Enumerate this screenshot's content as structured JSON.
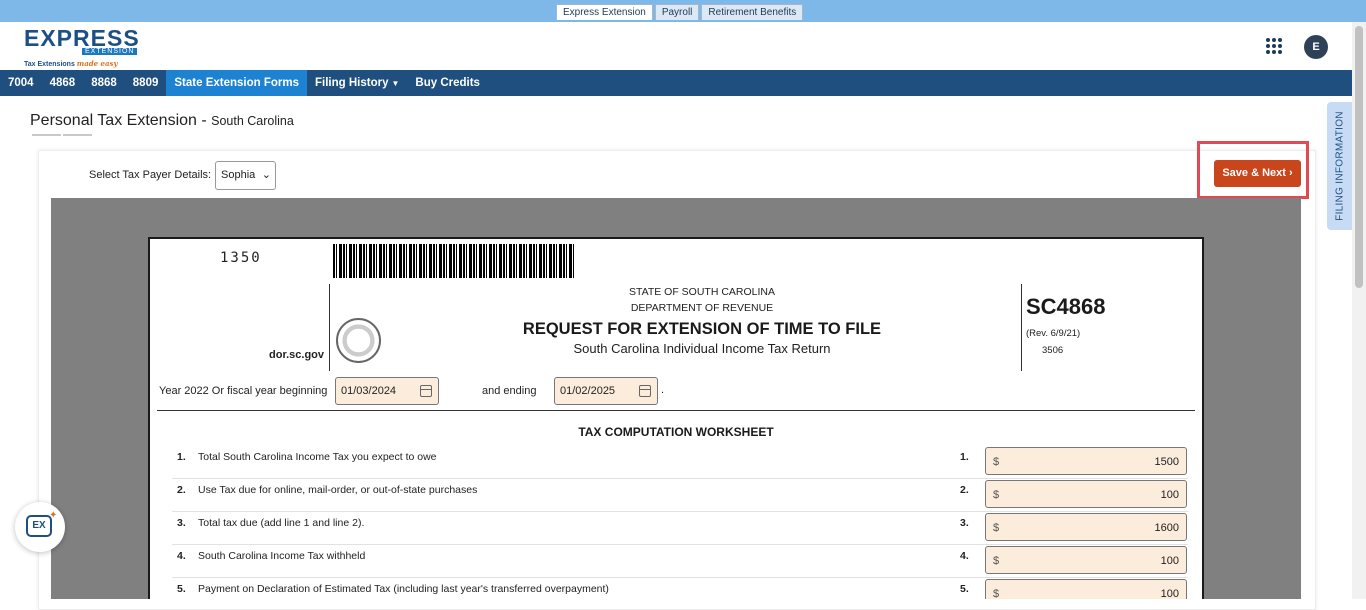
{
  "top_tabs": [
    {
      "label": "Express Extension",
      "active": true
    },
    {
      "label": "Payroll",
      "active": false
    },
    {
      "label": "Retirement Benefits",
      "active": false
    }
  ],
  "logo": {
    "main": "EXPRESS",
    "sub": "EXTENSION",
    "tag_a": "Tax Extensions",
    "tag_b": "made easy"
  },
  "user": {
    "avatar_initial": "E"
  },
  "nav": [
    {
      "label": "7004"
    },
    {
      "label": "4868"
    },
    {
      "label": "8868"
    },
    {
      "label": "8809"
    },
    {
      "label": "State Extension Forms",
      "active": true
    },
    {
      "label": "Filing History",
      "dropdown": true
    },
    {
      "label": "Buy Credits"
    }
  ],
  "page": {
    "title": "Personal Tax Extension - ",
    "subtitle": "South Carolina"
  },
  "taxpayer": {
    "label": "Select Tax Payer Details:",
    "selected": "Sophia"
  },
  "save_button": "Save & Next",
  "side_tab": "FILING INFORMATION",
  "form": {
    "number_code": "1350",
    "dor": "dor.sc.gov",
    "state_line1": "STATE OF SOUTH CAROLINA",
    "state_line2": "DEPARTMENT OF REVENUE",
    "title": "REQUEST FOR EXTENSION OF TIME TO FILE",
    "subtitle": "South Carolina Individual Income Tax Return",
    "form_no": "SC4868",
    "rev": "(Rev. 6/9/21)",
    "code": "3506",
    "year_label": "Year 2022 Or fiscal year beginning",
    "begin_date": "01/03/2024",
    "and_label": "and ending",
    "end_date": "01/02/2025",
    "worksheet_title": "TAX COMPUTATION WORKSHEET",
    "currency": "$",
    "lines": [
      {
        "num": "1.",
        "text": "Total South Carolina Income Tax you expect to owe",
        "amount": "1500"
      },
      {
        "num": "2.",
        "text": "Use Tax due for online, mail-order, or out-of-state purchases",
        "amount": "100"
      },
      {
        "num": "3.",
        "text": "Total tax due (add line 1 and line 2).",
        "amount": "1600"
      },
      {
        "num": "4.",
        "text": "South Carolina Income Tax withheld",
        "amount": "100"
      },
      {
        "num": "5.",
        "text": "Payment on Declaration of Estimated Tax (including last year's transferred overpayment)",
        "amount": "100"
      }
    ]
  },
  "chat": {
    "label": "EX"
  }
}
